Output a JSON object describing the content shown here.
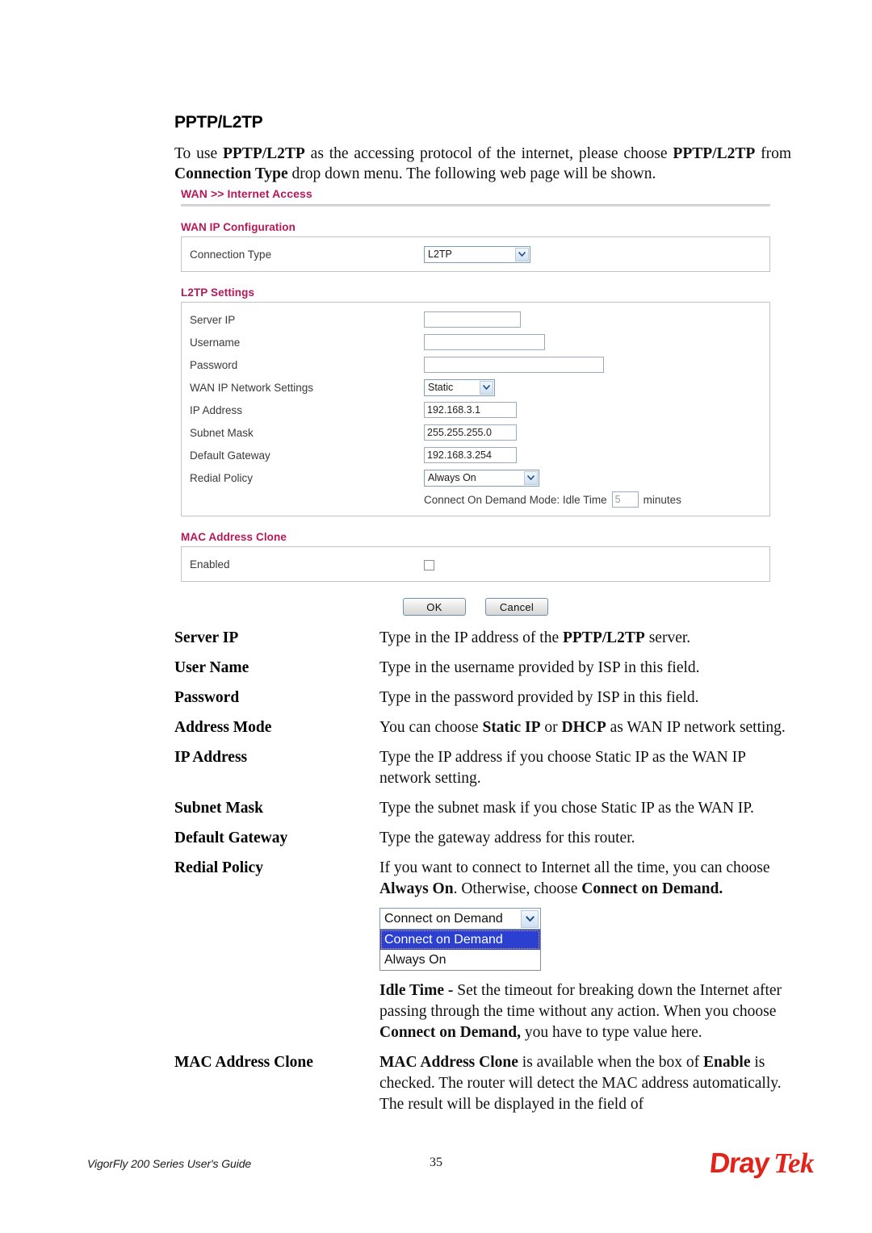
{
  "page": {
    "heading": "PPTP/L2TP",
    "intro_html": "To use <b>PPTP/L2TP</b> as the accessing protocol of the internet, please choose <b>PPTP/L2TP</b> from <b>Connection Type</b> drop down menu. The following web page will be shown."
  },
  "router_ui": {
    "breadcrumb": "WAN >> Internet Access",
    "wan_ip_configuration": {
      "title": "WAN IP Configuration",
      "connection_type_label": "Connection Type",
      "connection_type_value": "L2TP"
    },
    "l2tp_settings": {
      "title": "L2TP Settings",
      "rows": [
        {
          "label": "Server IP",
          "value": ""
        },
        {
          "label": "Username",
          "value": ""
        },
        {
          "label": "Password",
          "value": ""
        },
        {
          "label": "WAN IP Network Settings",
          "value": "Static"
        },
        {
          "label": "IP Address",
          "value": "192.168.3.1"
        },
        {
          "label": "Subnet Mask",
          "value": "255.255.255.0"
        },
        {
          "label": "Default Gateway",
          "value": "192.168.3.254"
        },
        {
          "label": "Redial Policy",
          "value": "Always On"
        }
      ],
      "idle_prefix": "Connect On Demand Mode: Idle Time",
      "idle_value": "5",
      "idle_suffix": "minutes"
    },
    "mac_address_clone": {
      "title": "MAC Address Clone",
      "enabled_label": "Enabled",
      "enabled_checked": false
    },
    "buttons": {
      "ok": "OK",
      "cancel": "Cancel"
    }
  },
  "definitions": [
    {
      "term": "Server IP",
      "desc_html": "Type in the IP address of the <b>PPTP/L2TP</b> server."
    },
    {
      "term": "User Name",
      "desc_html": "Type in the username provided by ISP in this field."
    },
    {
      "term": "Password",
      "desc_html": "Type in the password provided by ISP in this field."
    },
    {
      "term": "Address Mode",
      "desc_html": "You can choose <b>Static IP</b> or <b>DHCP</b> as WAN IP network setting."
    },
    {
      "term": "IP Address",
      "desc_html": "Type the IP address if you choose Static IP as the WAN IP network setting."
    },
    {
      "term": "Subnet Mask",
      "desc_html": "Type the subnet mask if you chose Static IP as the WAN IP."
    },
    {
      "term": "Default Gateway",
      "desc_html": "Type the gateway address for this router."
    },
    {
      "term": "Redial Policy",
      "desc_html": "If you want to connect to Internet all the time, you can choose <b>Always On</b>. Otherwise, choose <b>Connect on Demand.</b>",
      "dropdown": {
        "selected": "Connect on Demand",
        "options": [
          "Connect on Demand",
          "Always On"
        ]
      },
      "extra_html": "<b>Idle Time - </b>Set the timeout for breaking down the Internet after passing through the time without any action. When you choose <b>Connect on Demand,</b> you have to type value here."
    },
    {
      "term": "MAC Address Clone",
      "desc_html": "<b>MAC Address Clone</b> is available when the box of <b>Enable</b> is checked. The router will detect the MAC address automatically. The result will be displayed in the field of"
    }
  ],
  "footer": {
    "left": "VigorFly 200 Series User's Guide",
    "page_number": "35",
    "logo_part1": "Dray",
    "logo_part2": "Tek"
  },
  "colors": {
    "accent_pink": "#b5195b",
    "logo_red": "#e2231a",
    "select_highlight": "#2b3fd0"
  }
}
